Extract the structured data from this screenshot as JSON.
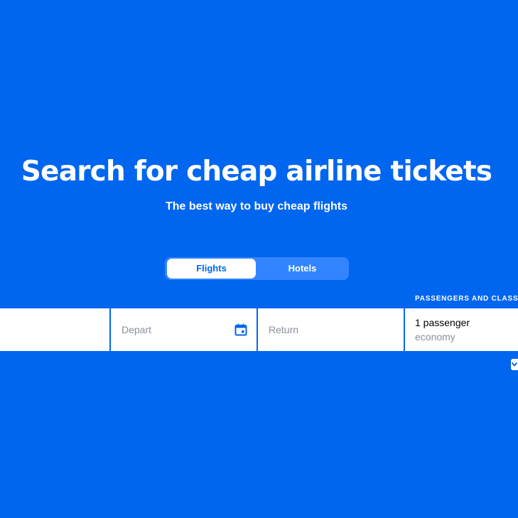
{
  "hero": {
    "title": "Search for cheap airline tickets",
    "subtitle": "The best way to buy cheap flights"
  },
  "tabs": [
    {
      "label": "Flights",
      "selected": true
    },
    {
      "label": "Hotels",
      "selected": false
    }
  ],
  "search_form": {
    "origin": {
      "value": "",
      "placeholder": ""
    },
    "depart": {
      "placeholder": "Depart",
      "icon": "calendar-icon"
    },
    "return": {
      "placeholder": "Return"
    },
    "passengers": {
      "caption": "PASSENGERS AND CLASS",
      "count": "1 passenger",
      "class": "economy",
      "icon": "chevron-down-icon"
    }
  },
  "colors": {
    "background": "#0066ef",
    "accent": "#0066ef",
    "tab_track": "#3385ff",
    "placeholder": "#8a9099"
  }
}
